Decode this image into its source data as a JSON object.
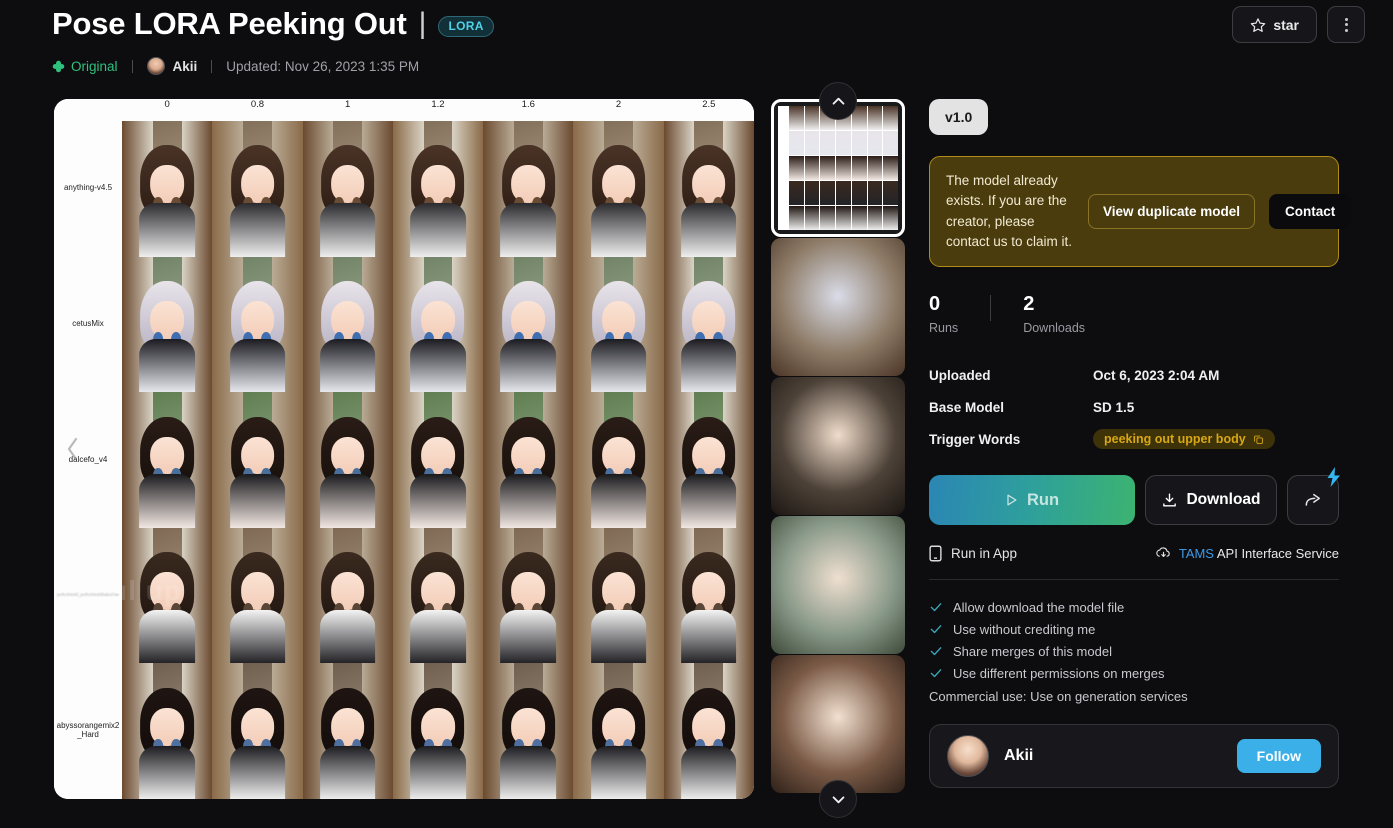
{
  "header": {
    "title": "Pose LORA Peeking Out",
    "title_separator": "|",
    "badge": "LORA",
    "original_label": "Original",
    "author": "Akii",
    "updated": "Updated: Nov 26, 2023 1:35 PM",
    "star_label": "star",
    "icons": {
      "clover": "clover-icon",
      "star": "star-icon",
      "more": "more-vertical-icon"
    }
  },
  "gallery": {
    "column_headers": [
      "0",
      "0.8",
      "1",
      "1.2",
      "1.6",
      "2",
      "2.5"
    ],
    "row_labels": [
      "anything-v4.5",
      "cetusMix",
      "dalcefo_v4",
      "perfectWorld_perfectWorldBakedVae",
      "abyssorangemix2_Hard"
    ],
    "watermark": "ul up",
    "watermark_secondary": "",
    "prev_arrow": "chevron-left-icon",
    "scroll_up": "chevron-up-icon",
    "scroll_down": "chevron-down-icon"
  },
  "panel": {
    "version": "v1.0",
    "notice": {
      "text": "The model already exists. If you are the creator, please contact us to claim it.",
      "view_duplicate_label": "View duplicate model",
      "contact_label": "Contact"
    },
    "stats": [
      {
        "value": "0",
        "label": "Runs"
      },
      {
        "value": "2",
        "label": "Downloads"
      }
    ],
    "info": [
      {
        "key": "Uploaded",
        "value": "Oct 6, 2023 2:04 AM"
      },
      {
        "key": "Base Model",
        "value": "SD 1.5"
      }
    ],
    "trigger_words_key": "Trigger Words",
    "trigger_words_value": "peeking out upper body",
    "actions": {
      "run_label": "Run",
      "download_label": "Download",
      "share_icon": "share-icon",
      "bolt_icon": "lightning-bolt-icon"
    },
    "run_in_app": "Run in App",
    "api_service_brand": "TAMS",
    "api_service_text": " API Interface Service",
    "permissions": [
      "Allow download the model file",
      "Use without crediting me",
      "Share merges of this model",
      "Use different permissions on merges"
    ],
    "commercial_use": "Commercial use: Use on generation services",
    "author_card": {
      "name": "Akii",
      "follow_label": "Follow"
    }
  },
  "colors": {
    "background": "#0d0d0f",
    "accent_teal": "#4fd2e8",
    "accent_blue": "#3bb0e8",
    "warning_bg": "#4a3c0d",
    "warning_border": "#b08c18",
    "trigger_text": "#d8a716",
    "green": "#2ec27e"
  }
}
